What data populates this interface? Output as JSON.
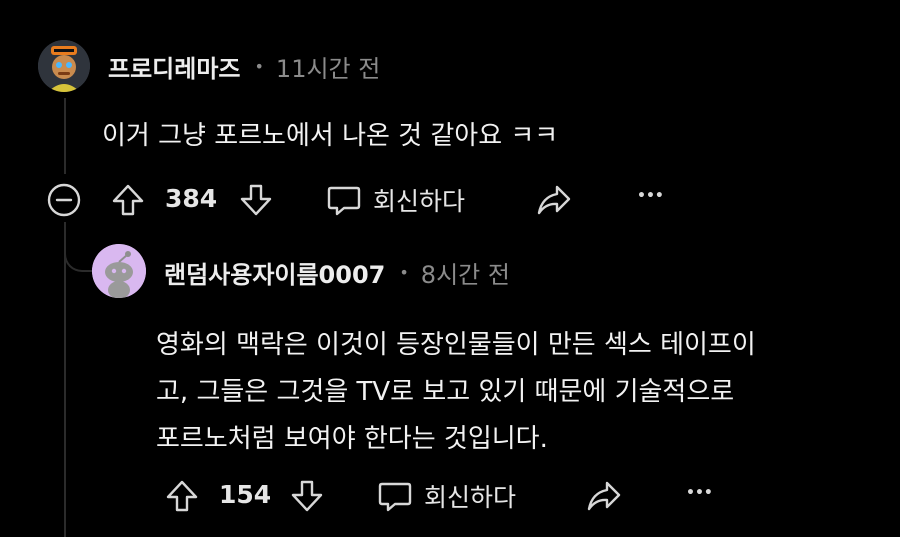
{
  "comment1": {
    "username": "프로디레마즈",
    "separator": "•",
    "time": "11시간 전",
    "body": "이거 그냥 포르노에서 나온 것 같아요 ㅋㅋ",
    "votes": "384",
    "reply_label": "회신하다",
    "more": "•••"
  },
  "comment2": {
    "username": "랜덤사용자이름0007",
    "separator": "•",
    "time": "8시간 전",
    "body_lines": [
      "영화의 맥락은 이것이 등장인물들이 만든 섹스 테이프이",
      "고, 그들은 그것을 TV로 보고 있기 때문에 기술적으로",
      "포르노처럼 보여야 한다는 것입니다."
    ],
    "votes": "154",
    "reply_label": "회신하다",
    "more": "•••"
  },
  "colors": {
    "background": "#000000",
    "text": "#f2f2f2",
    "muted": "#8b8b8b",
    "thread_line": "#2b2b2b",
    "avatar2_bg": "#d9b8f0"
  }
}
